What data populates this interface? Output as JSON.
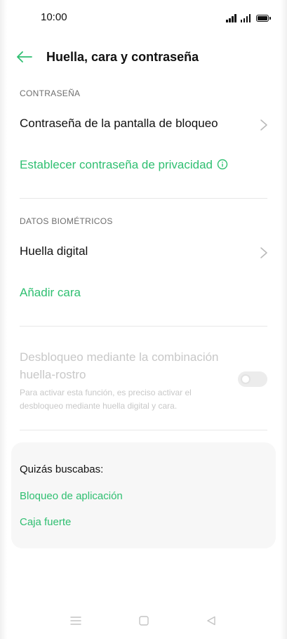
{
  "status_bar": {
    "time": "10:00",
    "icons": [
      "signal-icon",
      "signal-icon",
      "battery-icon"
    ]
  },
  "header": {
    "back_icon": "back-arrow-icon",
    "title": "Huella, cara y contraseña"
  },
  "sections": {
    "password": {
      "header": "CONTRASEÑA",
      "lock_screen_password": "Contraseña de la pantalla de bloqueo",
      "privacy_password": "Establecer contraseña de privacidad"
    },
    "biometrics": {
      "header": "DATOS BIOMÉTRICOS",
      "fingerprint": "Huella digital",
      "add_face": "Añadir cara"
    },
    "combo_unlock": {
      "title": "Desbloqueo mediante la combinación huella-rostro",
      "description": "Para activar esta función, es preciso activar el desbloqueo mediante huella digital y cara.",
      "enabled": false
    }
  },
  "suggestions": {
    "title": "Quizás buscabas:",
    "links": [
      "Bloqueo de aplicación",
      "Caja fuerte"
    ]
  },
  "nav_bar": {
    "buttons": [
      "menu-icon",
      "home-icon",
      "back-icon"
    ]
  },
  "colors": {
    "accent": "#2fbf71",
    "text": "#111111",
    "secondary": "#6e6e6e",
    "disabled": "#c8c8c8",
    "card": "#f7f7f7"
  }
}
